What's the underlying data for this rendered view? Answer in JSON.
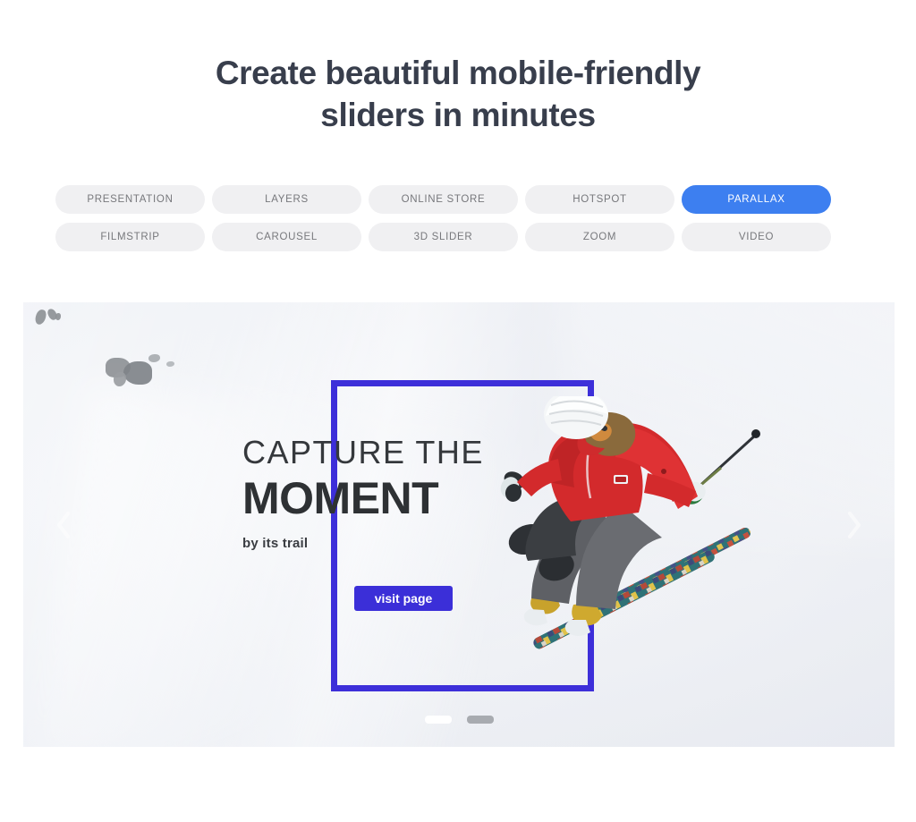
{
  "headline": {
    "line1": "Create beautiful mobile-friendly",
    "line2": "sliders in minutes"
  },
  "tabs": [
    {
      "label": "PRESENTATION",
      "active": false
    },
    {
      "label": "LAYERS",
      "active": false
    },
    {
      "label": "ONLINE STORE",
      "active": false
    },
    {
      "label": "HOTSPOT",
      "active": false
    },
    {
      "label": "PARALLAX",
      "active": true
    },
    {
      "label": "FILMSTRIP",
      "active": false
    },
    {
      "label": "CAROUSEL",
      "active": false
    },
    {
      "label": "3D SLIDER",
      "active": false
    },
    {
      "label": "ZOOM",
      "active": false
    },
    {
      "label": "VIDEO",
      "active": false
    }
  ],
  "slider": {
    "slide": {
      "title_line1": "CAPTURE THE",
      "title_line2": "MOMENT",
      "subtitle": "by its trail",
      "cta_label": "visit page",
      "scene": "skier jumping on snowy mountain slope"
    },
    "prev_icon": "chevron-left-icon",
    "next_icon": "chevron-right-icon",
    "bullets": [
      {
        "active": true
      },
      {
        "active": false
      }
    ]
  },
  "colors": {
    "heading": "#383e4c",
    "tab_bg": "#f0f0f2",
    "tab_text": "#77787c",
    "tab_active_bg": "#3d7ff0",
    "tab_active_text": "#ffffff",
    "frame_border": "#3d2fd9",
    "cta_bg": "#3b2fd8",
    "slide_title": "#2e3134",
    "bullet_active": "#ffffff",
    "bullet_inactive": "#a8abb0",
    "page_bg": "#ffffff"
  }
}
